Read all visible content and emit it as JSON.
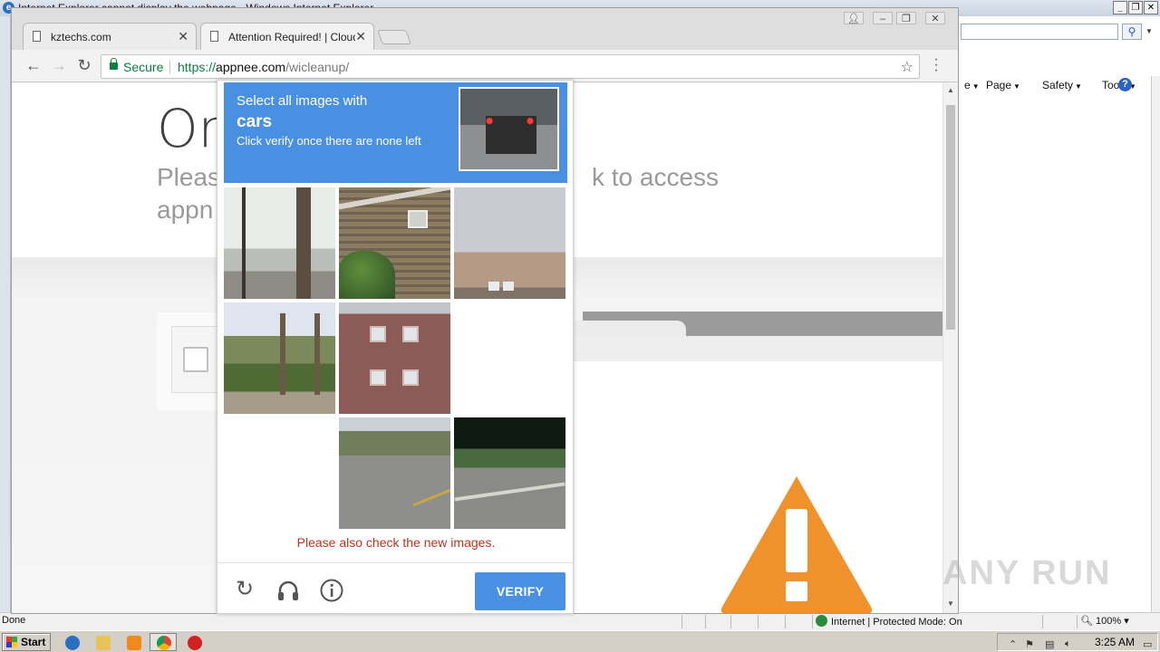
{
  "ie": {
    "title": "Internet Explorer cannot display the webpage - Windows Internet Explorer",
    "commands": [
      "Page",
      "Safety",
      "Tools"
    ],
    "status": "Done",
    "zone": "Internet | Protected Mode: On",
    "zoom": "100%"
  },
  "chrome": {
    "tabs": [
      {
        "title": "kztechs.com",
        "active": false
      },
      {
        "title": "Attention Required! | Cloudflare",
        "active": true
      }
    ],
    "omnibox": {
      "secure_label": "Secure",
      "scheme": "https://",
      "host": "appnee.com",
      "path": "/wicleanup/"
    }
  },
  "page": {
    "heading": "On",
    "subtitle_line1": "Pleas",
    "subtitle_line1_end": "k to access",
    "subtitle_line2": "appn"
  },
  "captcha": {
    "select_text": "Select all images with",
    "target": "cars",
    "instruction": "Click verify once there are none left",
    "error": "Please also check the new images.",
    "verify_label": "VERIFY",
    "tiles": [
      "street-sign-pole",
      "brick-wall-ac-unit",
      "rooftop-sky",
      "palm-trees-road",
      "brick-house",
      "loading-blank",
      "loading-blank",
      "road-crosswalk",
      "road-trees"
    ],
    "tools": [
      "reload-icon",
      "audio-icon",
      "info-icon"
    ]
  },
  "watermark": "ANY RUN",
  "taskbar": {
    "start_label": "Start",
    "clock": "3:25 AM"
  },
  "colors": {
    "captcha_blue": "#4a90e2",
    "error_red": "#c2321d",
    "secure_green": "#0b8043",
    "warning_orange": "#f0922b"
  }
}
